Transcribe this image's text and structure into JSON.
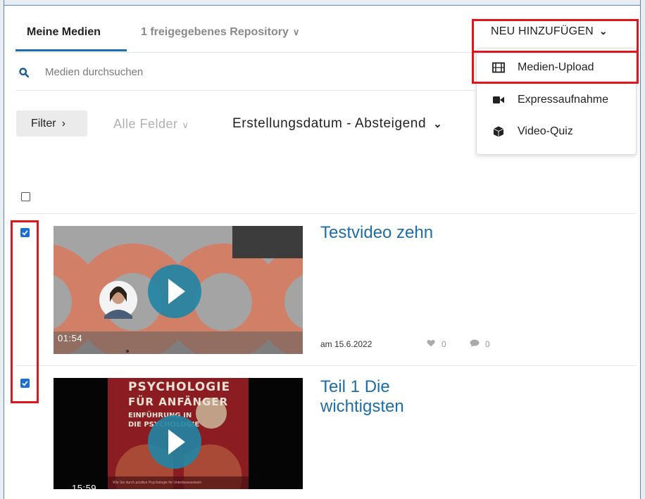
{
  "tabs": {
    "active": "Meine Medien",
    "repository": "1 freigegebenes Repository"
  },
  "add_menu": {
    "button_label": "NEU HINZUFÜGEN",
    "items": [
      {
        "label": "Medien-Upload",
        "icon": "film-icon"
      },
      {
        "label": "Expressaufnahme",
        "icon": "video-camera-icon"
      },
      {
        "label": "Video-Quiz",
        "icon": "cube-icon"
      }
    ]
  },
  "search": {
    "placeholder": "Medien durchsuchen"
  },
  "filters": {
    "filter_label": "Filter",
    "fields_label": "Alle Felder",
    "sort_label": "Erstellungsdatum - Absteigend"
  },
  "media": [
    {
      "title": "Testvideo zehn",
      "duration": "01:54",
      "date": "am 15.6.2022",
      "likes": "0",
      "comments": "0",
      "checked": true
    },
    {
      "title": "Teil 1 Die wichtigsten",
      "duration": "15:59",
      "thumb_text": {
        "line1": "PSYCHOLOGIE",
        "line2": "FÜR ANFÄNGER",
        "line3": "EINFÜHRUNG IN",
        "line4": "DIE PSYCHOLOGIE",
        "footer": "Wie Sie durch positive Psychologie Ihr Unterbewusstsein"
      },
      "checked": true
    }
  ],
  "colors": {
    "accent": "#1b6fb4",
    "link": "#1c6da8",
    "highlight": "#e3141b",
    "checkbox": "#1b6fd2"
  }
}
